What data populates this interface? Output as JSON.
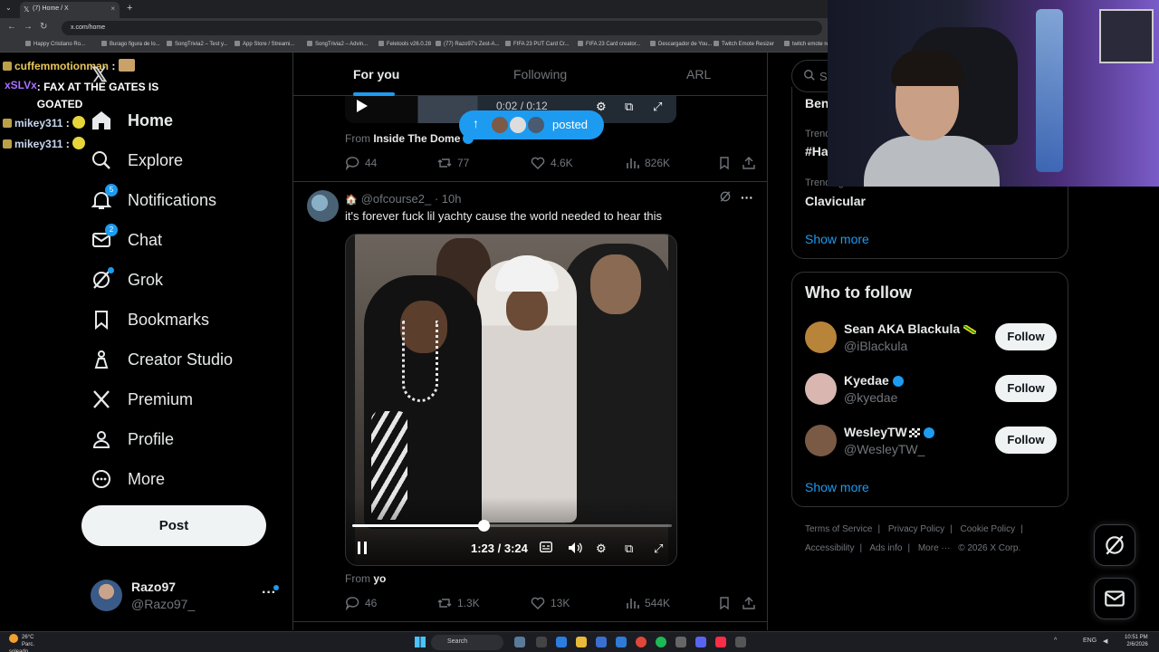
{
  "browser": {
    "tab_title": "(7) Home / X",
    "url": "x.com/home",
    "bookmarks": [
      "Happy Cristiano Ro...",
      "Burago figura de lo...",
      "SongTrivia2 – Test y...",
      "App Store / Streami...",
      "SongTrivia2 – Advin...",
      "Feletools v26.0.28",
      "(77) Razo97's Zest-A...",
      "FIFA 23 PUT Card Cr...",
      "FIFA 23 Card creator...",
      "Descargador de You...",
      "Twitch Emote Resizer",
      "twitch emote re..."
    ]
  },
  "chat": [
    {
      "user": "cuffemmotionman",
      "text": ":"
    },
    {
      "user": "xSLVx",
      "text": ": FAX AT THE GATES IS GOATED"
    },
    {
      "user": "mikey311",
      "text": ":"
    },
    {
      "user": "mikey311",
      "text": ":"
    }
  ],
  "sidebar": {
    "items": [
      {
        "label": "Home",
        "icon": "home-icon"
      },
      {
        "label": "Explore",
        "icon": "search-icon"
      },
      {
        "label": "Notifications",
        "icon": "bell-icon",
        "badge": "5"
      },
      {
        "label": "Chat",
        "icon": "mail-icon",
        "badge": "2"
      },
      {
        "label": "Grok",
        "icon": "grok-icon"
      },
      {
        "label": "Bookmarks",
        "icon": "bookmark-icon"
      },
      {
        "label": "Creator Studio",
        "icon": "creator-studio-icon"
      },
      {
        "label": "Premium",
        "icon": "x-premium-icon"
      },
      {
        "label": "Profile",
        "icon": "person-icon"
      },
      {
        "label": "More",
        "icon": "more-circle-icon"
      }
    ],
    "post_label": "Post",
    "account": {
      "name": "Razo97",
      "handle": "@Razo97_"
    }
  },
  "feed": {
    "tabs": [
      "For you",
      "Following",
      "ARL"
    ],
    "active_tab": "For you",
    "posted_pill": "posted",
    "prev_post": {
      "video_time": "0:02 / 0:12",
      "from_label": "From",
      "from_name": "Inside The Dome",
      "replies": "44",
      "reposts": "77",
      "likes": "4.6K",
      "views": "826K"
    },
    "post": {
      "handle": "@ofcourse2_",
      "time": "10h",
      "text": "it's forever fuck lil yachty cause the world needed to hear this",
      "video_time": "1:23 / 3:24",
      "progress": 0.41,
      "from_label": "From",
      "from_name": "yo",
      "replies": "46",
      "reposts": "1.3K",
      "likes": "13K",
      "views": "544K"
    }
  },
  "right": {
    "search_placeholder": "Se",
    "trends": [
      {
        "label": "",
        "title": "Ben"
      },
      {
        "label": "Trending",
        "title": "#Ha"
      },
      {
        "label": "Trending",
        "title": "Clavicular"
      }
    ],
    "show_more": "Show more",
    "who_to_follow": {
      "title": "Who to follow",
      "users": [
        {
          "name": "Sean AKA Blackula",
          "handle": "@iBlackula",
          "follow": "Follow",
          "color": "#b8843a"
        },
        {
          "name": "Kyedae",
          "handle": "@kyedae",
          "follow": "Follow",
          "color": "#d9b6b0"
        },
        {
          "name": "WesleyTW",
          "handle": "@WesleyTW_",
          "follow": "Follow",
          "color": "#7a5a44"
        }
      ],
      "show_more": "Show more"
    },
    "footer": {
      "line1": [
        "Terms of Service",
        "|",
        "Privacy Policy",
        "|",
        "Cookie Policy",
        "|"
      ],
      "line2": [
        "Accessibility",
        "|",
        "Ads info",
        "|",
        "More ···",
        "© 2026 X Corp."
      ]
    }
  },
  "taskbar": {
    "weather_temp": "26°C",
    "weather_text": "Parc. soleado",
    "search": "Search",
    "lang": "ENG",
    "time": "10:51 PM",
    "date": "2/6/2026"
  },
  "colors": {
    "accent": "#1d9bf0",
    "text": "#e7e9ea",
    "muted": "#71767b",
    "border": "#2f3336"
  }
}
